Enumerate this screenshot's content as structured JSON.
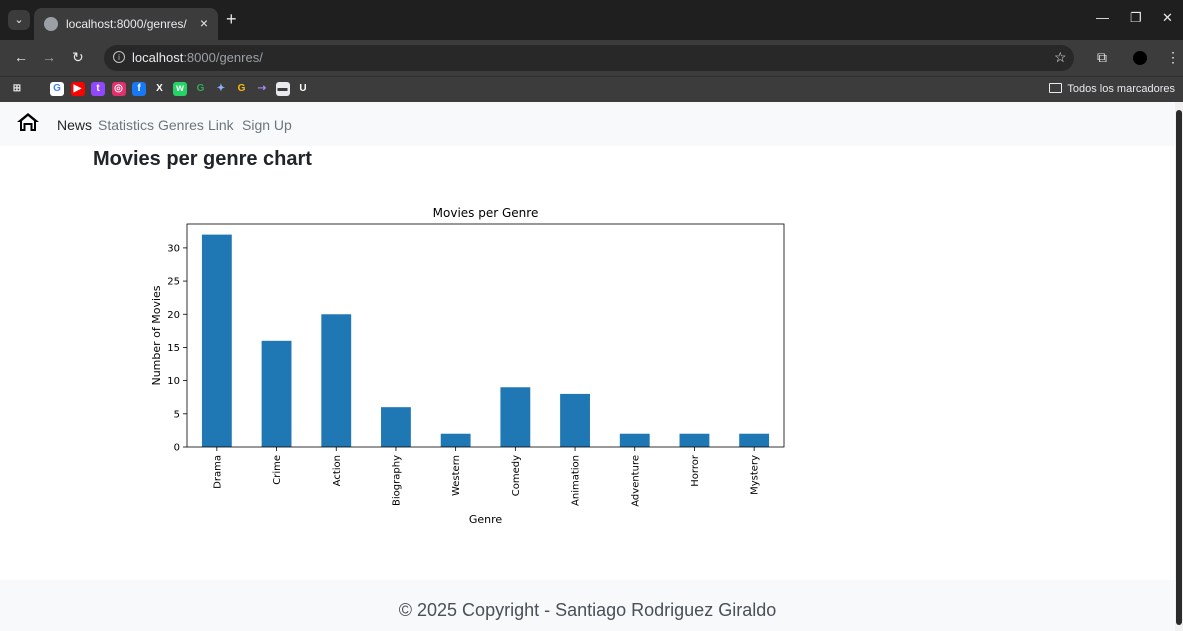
{
  "browser": {
    "tab_title": "localhost:8000/genres/",
    "tab_close": "×",
    "new_tab": "+",
    "url_host": "localhost",
    "url_path": ":8000/genres/",
    "bookmarks_all": "Todos los marcadores",
    "bookmark_icons": [
      {
        "name": "google-icon",
        "color": "#ffffff",
        "glyph": "G",
        "fg": "#4285f4"
      },
      {
        "name": "youtube-icon",
        "color": "#ff0000",
        "glyph": "▶",
        "fg": "#ffffff"
      },
      {
        "name": "twitch-icon",
        "color": "#9146ff",
        "glyph": "t",
        "fg": "#ffffff"
      },
      {
        "name": "instagram-icon",
        "color": "#e1306c",
        "glyph": "◎",
        "fg": "#ffffff"
      },
      {
        "name": "facebook-icon",
        "color": "#1877f2",
        "glyph": "f",
        "fg": "#ffffff"
      },
      {
        "name": "x-icon",
        "color": "#3c3c3c",
        "glyph": "X",
        "fg": "#ffffff"
      },
      {
        "name": "whatsapp-icon",
        "color": "#25d366",
        "glyph": "w",
        "fg": "#ffffff"
      },
      {
        "name": "google-g-icon",
        "color": "#3c3c3c",
        "glyph": "G",
        "fg": "#34a853"
      },
      {
        "name": "gemini-icon",
        "color": "#3c3c3c",
        "glyph": "✦",
        "fg": "#8ab4f8"
      },
      {
        "name": "google-g2-icon",
        "color": "#3c3c3c",
        "glyph": "G",
        "fg": "#fbbc04"
      },
      {
        "name": "link-icon",
        "color": "#3c3c3c",
        "glyph": "⇢",
        "fg": "#a78bfa"
      },
      {
        "name": "image-icon",
        "color": "#e8eaed",
        "glyph": "▬",
        "fg": "#3c3c3c"
      },
      {
        "name": "u-icon",
        "color": "#3c3c3c",
        "glyph": "U",
        "fg": "#ffffff"
      }
    ]
  },
  "nav": {
    "links": [
      "News",
      "Statistics",
      "Genres",
      "Link",
      "Sign Up"
    ]
  },
  "page": {
    "title": "Movies per genre chart",
    "footer": "© 2025 Copyright - Santiago Rodriguez Giraldo"
  },
  "colors": {
    "bar": "#1f77b4"
  },
  "chart_data": {
    "type": "bar",
    "title": "Movies per Genre",
    "xlabel": "Genre",
    "ylabel": "Number of Movies",
    "categories": [
      "Drama",
      "Crime",
      "Action",
      "Biography",
      "Western",
      "Comedy",
      "Animation",
      "Adventure",
      "Horror",
      "Mystery"
    ],
    "values": [
      32,
      16,
      20,
      6,
      2,
      9,
      8,
      2,
      2,
      2
    ],
    "ylim": [
      0,
      33.6
    ],
    "yticks": [
      0,
      5,
      10,
      15,
      20,
      25,
      30
    ],
    "grid": false
  }
}
